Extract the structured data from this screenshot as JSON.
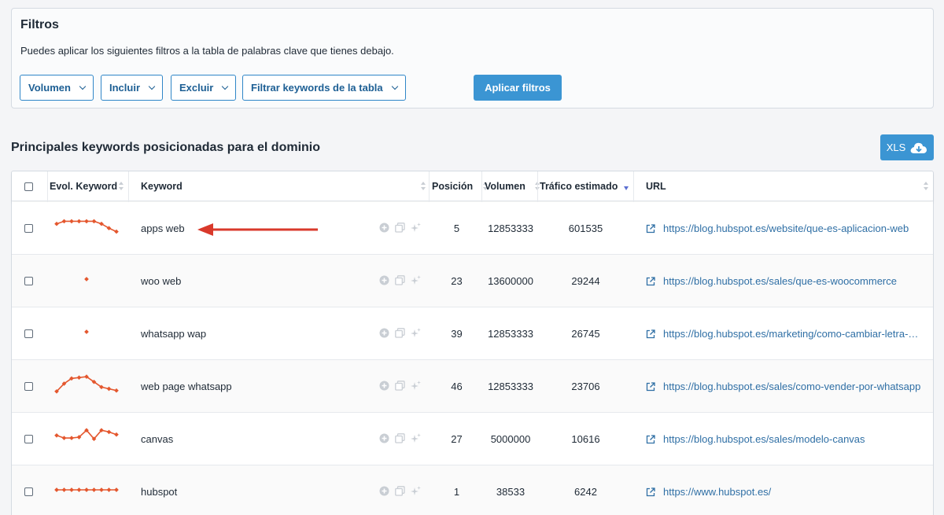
{
  "filters": {
    "title": "Filtros",
    "description": "Puedes aplicar los siguientes filtros a la tabla de palabras clave que tienes debajo.",
    "buttons": [
      "Volumen",
      "Incluir",
      "Excluir",
      "Filtrar keywords de la tabla"
    ],
    "apply_label": "Aplicar filtros"
  },
  "section": {
    "title": "Principales keywords posicionadas para el dominio",
    "xls_label": "XLS"
  },
  "table": {
    "columns": {
      "evol": "Evol. Keyword",
      "keyword": "Keyword",
      "position": "Posición",
      "volume": "Volumen",
      "traffic": "Tráfico estimado",
      "url": "URL"
    },
    "sorted_by": "traffic",
    "sort_direction": "desc",
    "rows": [
      {
        "keyword": "apps web",
        "position": "5",
        "volume": "12853333",
        "traffic": "601535",
        "url": "https://blog.hubspot.es/website/que-es-aplicacion-web",
        "trend": [
          0.35,
          0.2,
          0.2,
          0.2,
          0.2,
          0.2,
          0.35,
          0.6,
          0.8
        ]
      },
      {
        "keyword": "woo web",
        "position": "23",
        "volume": "13600000",
        "traffic": "29244",
        "url": "https://blog.hubspot.es/sales/que-es-woocommerce",
        "trend": [
          null,
          null,
          null,
          null,
          0.5,
          null,
          null,
          null,
          null
        ]
      },
      {
        "keyword": "whatsapp wap",
        "position": "39",
        "volume": "12853333",
        "traffic": "26745",
        "url": "https://blog.hubspot.es/marketing/como-cambiar-letra-…",
        "trend": [
          null,
          null,
          null,
          null,
          0.5,
          null,
          null,
          null,
          null
        ]
      },
      {
        "keyword": "web page whatsapp",
        "position": "46",
        "volume": "12853333",
        "traffic": "23706",
        "url": "https://blog.hubspot.es/sales/como-vender-por-whatsapp",
        "trend": [
          0.9,
          0.45,
          0.15,
          0.1,
          0.05,
          0.35,
          0.65,
          0.75,
          0.85
        ]
      },
      {
        "keyword": "canvas",
        "position": "27",
        "volume": "5000000",
        "traffic": "10616",
        "url": "https://blog.hubspot.es/sales/modelo-canvas",
        "trend": [
          0.4,
          0.55,
          0.55,
          0.5,
          0.1,
          0.6,
          0.1,
          0.2,
          0.35
        ]
      },
      {
        "keyword": "hubspot",
        "position": "1",
        "volume": "38533",
        "traffic": "6242",
        "url": "https://www.hubspot.es/",
        "trend": [
          0.5,
          0.5,
          0.5,
          0.5,
          0.5,
          0.5,
          0.5,
          0.5,
          0.5
        ]
      }
    ]
  },
  "colors": {
    "accent": "#3b95d3",
    "trend": "#e4572e",
    "arrow": "#d9392b",
    "link": "#2f6fa5"
  },
  "icons": [
    "chevron-down-icon",
    "cloud-download-icon",
    "external-link-icon",
    "add-icon",
    "copy-icon",
    "sparkle-icon",
    "sort-icon"
  ]
}
